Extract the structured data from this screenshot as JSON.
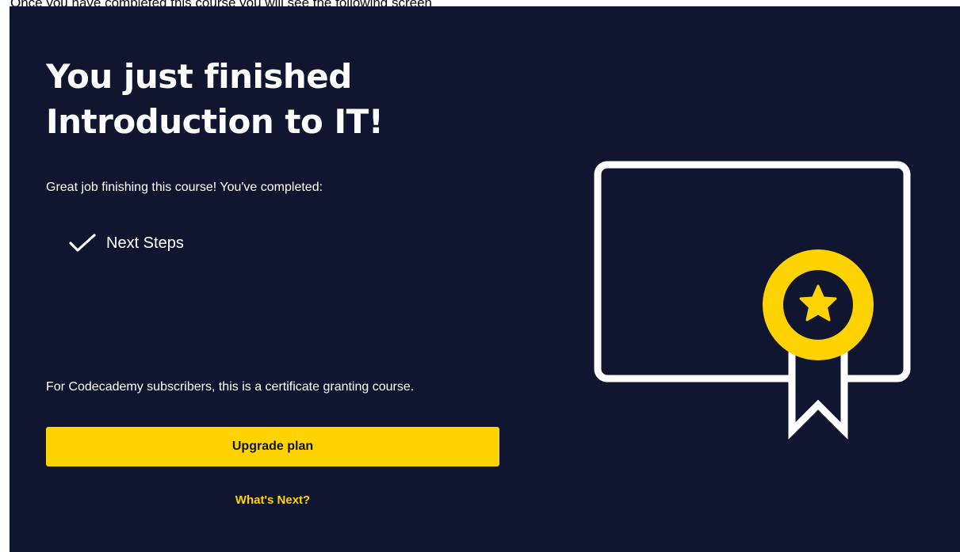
{
  "caption": "Once you have completed this course you will see the following screen",
  "headline": {
    "line1": "You just finished",
    "line2": "Introduction to IT!"
  },
  "subtitle": "Great job finishing this course! You've completed:",
  "completed_items": [
    "Next Steps"
  ],
  "certificate_note": "For Codecademy subscribers, this is a certificate granting course.",
  "upgrade_button_label": "Upgrade plan",
  "whats_next_label": "What's Next?",
  "icons": {
    "completed_item": "check-icon",
    "illustration": "certificate-icon",
    "badge": "award-ribbon-icon",
    "badge_center": "star-icon"
  },
  "colors": {
    "background": "#10162f",
    "accent": "#ffd300",
    "text": "#ffffff"
  }
}
